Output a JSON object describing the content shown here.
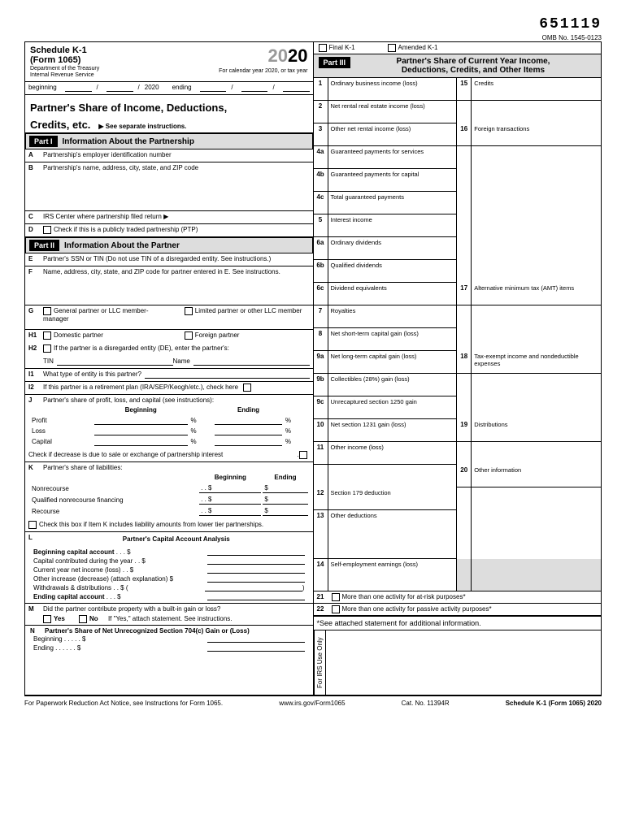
{
  "top_code": "651119",
  "omb": "OMB No. 1545-0123",
  "form": {
    "schedule": "Schedule K-1",
    "number": "(Form 1065)",
    "dept": "Department of the Treasury",
    "irs": "Internal Revenue Service"
  },
  "year": {
    "prefix": "20",
    "suffix": "20"
  },
  "cal_year": "For calendar year 2020, or tax year",
  "date": {
    "beginning_lbl": "beginning",
    "beginning_y": "2020",
    "ending_lbl": "ending"
  },
  "main_title": "Partner's Share of Income, Deductions,",
  "main_title2": "Credits, etc.",
  "see_inst": "▶ See separate instructions.",
  "final": "Final K-1",
  "amended": "Amended K-1",
  "part1": {
    "num": "Part I",
    "title": "Information About the Partnership"
  },
  "part2": {
    "num": "Part II",
    "title": "Information About the Partner"
  },
  "part3": {
    "num": "Part III",
    "title": "Partner's Share of Current Year Income,",
    "title2": "Deductions, Credits, and Other Items"
  },
  "A": "Partnership's employer identification number",
  "B": "Partnership's name, address, city, state, and ZIP code",
  "C": "IRS Center where partnership filed return ▶",
  "D": "Check if this is a publicly traded partnership (PTP)",
  "E": "Partner's SSN or TIN (Do not use TIN of a disregarded entity. See instructions.)",
  "F": "Name, address, city, state, and ZIP code for partner entered in E. See instructions.",
  "G": {
    "gp": "General partner or LLC member-manager",
    "lp": "Limited partner or other LLC member"
  },
  "H1": {
    "dp": "Domestic partner",
    "fp": "Foreign partner"
  },
  "H2": "If the partner is a disregarded entity (DE), enter the partner's:",
  "H2_tin": "TIN",
  "H2_name": "Name",
  "I1": "What type of entity is this partner?",
  "I2": "If this partner is a retirement plan (IRA/SEP/Keogh/etc.), check here",
  "J": {
    "title": "Partner's share of profit, loss, and capital (see instructions):",
    "beg": "Beginning",
    "end": "Ending",
    "profit": "Profit",
    "loss": "Loss",
    "capital": "Capital",
    "check": "Check if decrease is due to sale or exchange of partnership interest"
  },
  "K": {
    "title": "Partner's share of liabilities:",
    "beg": "Beginning",
    "end": "Ending",
    "nr": "Nonrecourse",
    "qnf": "Qualified nonrecourse financing",
    "rec": "Recourse",
    "check": "Check this box if Item K includes liability amounts from lower tier partnerships."
  },
  "L": {
    "title": "Partner's Capital Account Analysis",
    "beg": "Beginning capital account",
    "contrib": "Capital contributed during the year",
    "net": "Current year net income (loss)",
    "other": "Other increase (decrease) (attach explanation)",
    "wd": "Withdrawals & distributions",
    "end": "Ending capital account"
  },
  "M": {
    "q": "Did the partner contribute property with a built-in gain or loss?",
    "yes": "Yes",
    "no": "No",
    "note": "If \"Yes,\" attach statement. See instructions."
  },
  "N": {
    "title": "Partner's Share of Net Unrecognized Section 704(c) Gain or (Loss)",
    "beg": "Beginning",
    "end": "Ending"
  },
  "p3items": {
    "1": "Ordinary business income (loss)",
    "2": "Net rental real estate income (loss)",
    "3": "Other net rental income (loss)",
    "4a": "Guaranteed payments for services",
    "4b": "Guaranteed payments for capital",
    "4c": "Total guaranteed payments",
    "5": "Interest income",
    "6a": "Ordinary dividends",
    "6b": "Qualified dividends",
    "6c": "Dividend equivalents",
    "7": "Royalties",
    "8": "Net short-term capital gain (loss)",
    "9a": "Net long-term capital gain (loss)",
    "9b": "Collectibles (28%) gain (loss)",
    "9c": "Unrecaptured section 1250 gain",
    "10": "Net section 1231 gain (loss)",
    "11": "Other income (loss)",
    "12": "Section 179 deduction",
    "13": "Other deductions",
    "14": "Self-employment earnings (loss)",
    "15": "Credits",
    "16": "Foreign transactions",
    "17": "Alternative minimum tax (AMT) items",
    "18": "Tax-exempt income and nondeductible expenses",
    "19": "Distributions",
    "20": "Other information",
    "21": "More than one activity for at-risk purposes*",
    "22": "More than one activity for passive activity purposes*"
  },
  "att": "*See attached statement for additional information.",
  "irs_use": "For IRS Use Only",
  "footer": {
    "pra": "For Paperwork Reduction Act Notice, see Instructions for Form 1065.",
    "url": "www.irs.gov/Form1065",
    "cat": "Cat. No. 11394R",
    "form": "Schedule K-1 (Form 1065) 2020"
  }
}
